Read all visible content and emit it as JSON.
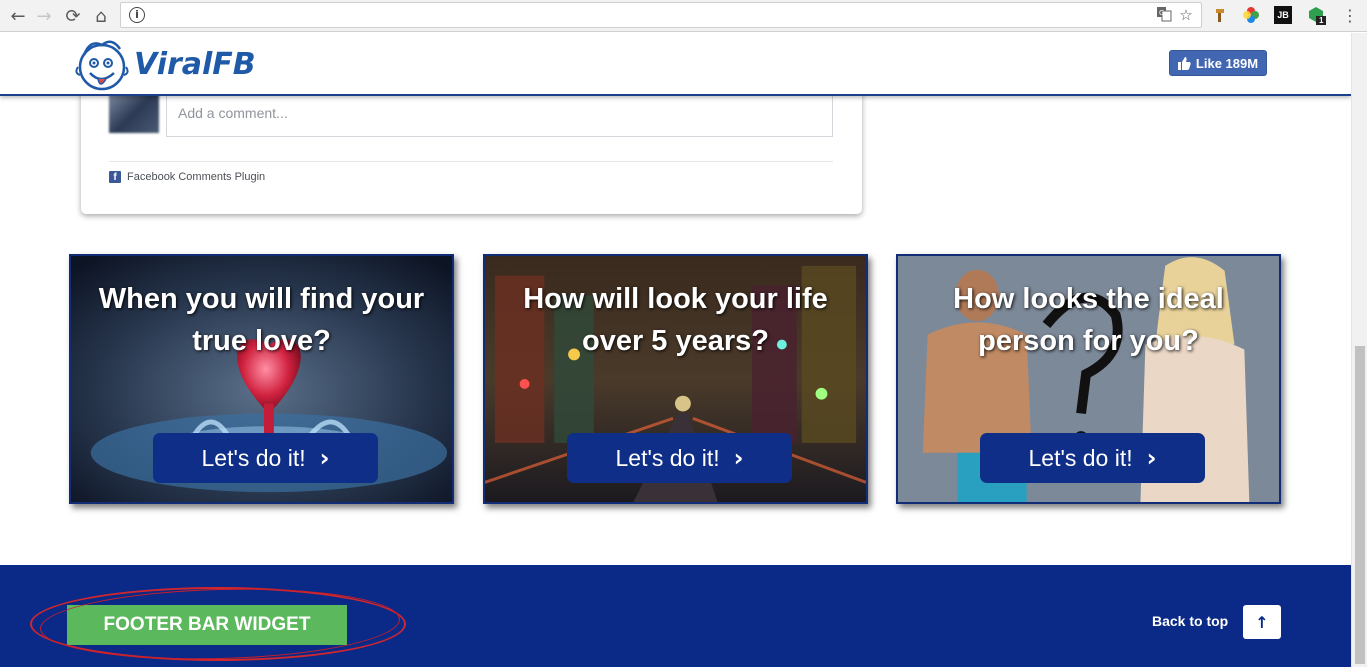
{
  "browser": {
    "back_icon": "←",
    "forward_icon": "→",
    "reload_icon": "⟳",
    "home_icon": "⌂",
    "info_icon": "i",
    "translate_icon": "translate-icon",
    "star_icon": "☆",
    "menu_icon": "⋮",
    "extensions": [
      "hammer-icon",
      "color-wheel-icon",
      "jb-icon",
      "gem-icon"
    ],
    "ext_jb_label": "JB",
    "ext_badge": "1"
  },
  "header": {
    "logo_text": "ViralFB",
    "like_label": "Like 189M"
  },
  "comments": {
    "placeholder": "Add a comment...",
    "plugin_label": "Facebook Comments Plugin",
    "plugin_icon": "f"
  },
  "quizzes": [
    {
      "title_line1": "When you will find your",
      "title_line2": "true love?",
      "button": "Let's do it!"
    },
    {
      "title_line1": "How will look your life",
      "title_line2": "over 5 years?",
      "button": "Let's do it!"
    },
    {
      "title_line1": "How looks the ideal",
      "title_line2": "person for you?",
      "button": "Let's do it!"
    }
  ],
  "footer": {
    "widget_label": "FOOTER BAR WIDGET",
    "back_to_top": "Back to top",
    "back_to_top_icon": "↑"
  },
  "colors": {
    "brand_blue": "#0b2987",
    "header_border": "#1b3f8b",
    "widget_green": "#5cb85c",
    "annotation_red": "#d0262e",
    "fb_blue": "#4267b2"
  }
}
